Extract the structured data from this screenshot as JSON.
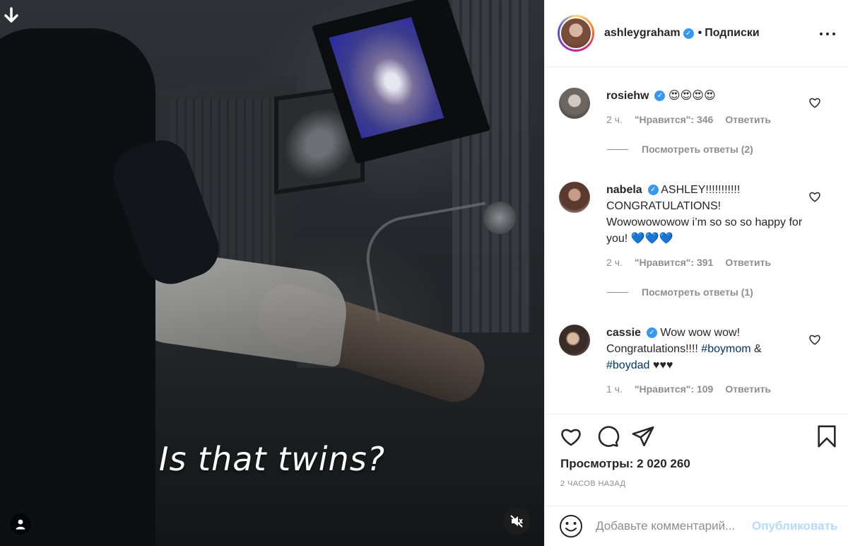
{
  "video": {
    "caption": "Is that twins?"
  },
  "header": {
    "username": "ashleygraham",
    "dot": "•",
    "follow_label": "Подписки"
  },
  "comments": [
    {
      "username": "rosiehw",
      "text": "😍😍😍😍",
      "time": "2 ч.",
      "likes": "\"Нравится\": 346",
      "reply": "Ответить",
      "view_replies": "Посмотреть ответы (2)"
    },
    {
      "username": "nabela",
      "text": "ASHLEY!!!!!!!!!!! CONGRATULATIONS! Wowowowowow i’m so so so happy for you! 💙💙💙",
      "time": "2 ч.",
      "likes": "\"Нравится\": 391",
      "reply": "Ответить",
      "view_replies": "Посмотреть ответы (1)"
    },
    {
      "username": "cassie",
      "text_before": "Wow wow wow! Congratulations!!!! ",
      "hashtag1": "#boymom",
      "amp": " & ",
      "hashtag2": "#boydad",
      "text_after": " ♥♥♥",
      "time": "1 ч.",
      "likes": "\"Нравится\": 109",
      "reply": "Ответить"
    }
  ],
  "stats": {
    "views": "Просмотры: 2 020 260",
    "age": "2 ЧАСОВ НАЗАД"
  },
  "comment_input": {
    "placeholder": "Добавьте комментарий...",
    "post_label": "Опубликовать"
  },
  "icons": [
    "download-arrow-icon",
    "user-tag-icon",
    "mute-icon",
    "more-icon",
    "heart-icon",
    "comment-icon",
    "share-icon",
    "bookmark-icon",
    "emoji-icon",
    "verified-icon"
  ]
}
